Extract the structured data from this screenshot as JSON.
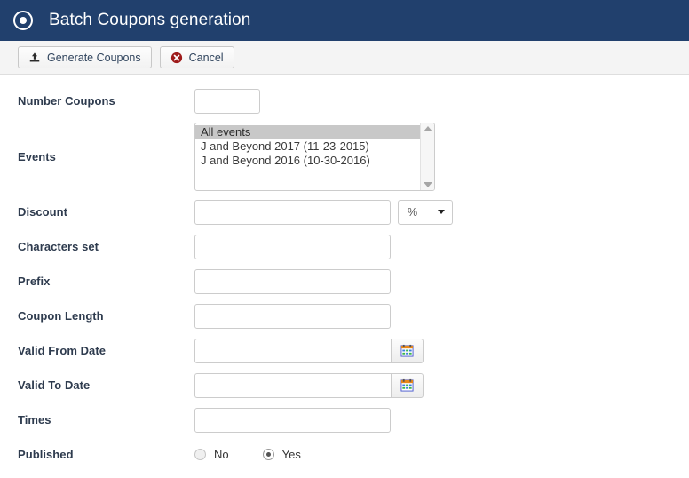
{
  "header": {
    "title": "Batch Coupons generation",
    "icon": "target-circle-icon",
    "background_color": "#21406d"
  },
  "toolbar": {
    "generate_label": "Generate Coupons",
    "generate_icon": "upload-icon",
    "cancel_label": "Cancel",
    "cancel_icon": "cancel-circle-icon",
    "cancel_icon_color": "#9e1b1b"
  },
  "form": {
    "number_coupons": {
      "label": "Number Coupons",
      "value": ""
    },
    "events": {
      "label": "Events",
      "options": [
        {
          "text": "All events",
          "selected": true
        },
        {
          "text": "J and Beyond 2017 (11-23-2015)",
          "selected": false
        },
        {
          "text": "J and Beyond 2016 (10-30-2016)",
          "selected": false
        }
      ]
    },
    "discount": {
      "label": "Discount",
      "value": "",
      "unit_selected": "%",
      "unit_options": [
        "%"
      ]
    },
    "characters_set": {
      "label": "Characters set",
      "value": ""
    },
    "prefix": {
      "label": "Prefix",
      "value": ""
    },
    "coupon_length": {
      "label": "Coupon Length",
      "value": ""
    },
    "valid_from": {
      "label": "Valid From Date",
      "value": "",
      "button_icon": "calendar-icon"
    },
    "valid_to": {
      "label": "Valid To Date",
      "value": "",
      "button_icon": "calendar-icon"
    },
    "times": {
      "label": "Times",
      "value": ""
    },
    "published": {
      "label": "Published",
      "options": [
        {
          "label": "No",
          "selected": false
        },
        {
          "label": "Yes",
          "selected": true
        }
      ]
    }
  }
}
